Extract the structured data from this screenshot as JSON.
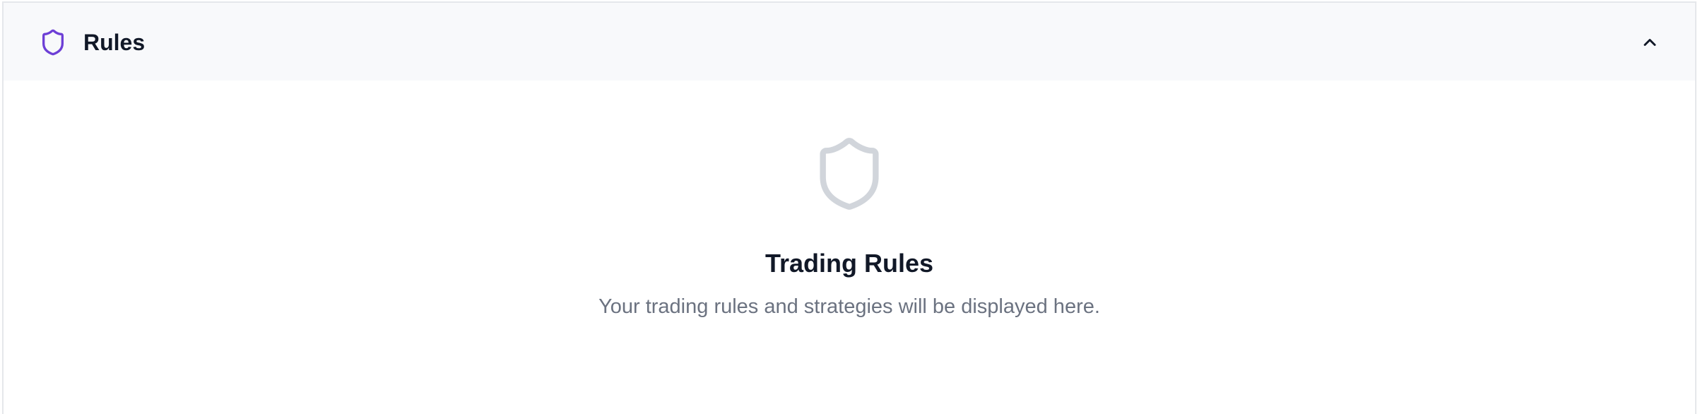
{
  "panel": {
    "title": "Rules",
    "header_icon": "shield-icon",
    "toggle_icon": "chevron-up-icon",
    "expanded": true
  },
  "empty_state": {
    "icon": "shield-icon",
    "title": "Trading Rules",
    "description": "Your trading rules and strategies will be displayed here."
  },
  "colors": {
    "accent": "#6d3fd6",
    "header_bg": "#f8f9fb",
    "muted_icon": "#d1d5db",
    "title_text": "#111827",
    "muted_text": "#6b7280",
    "border": "#e5e7eb"
  }
}
